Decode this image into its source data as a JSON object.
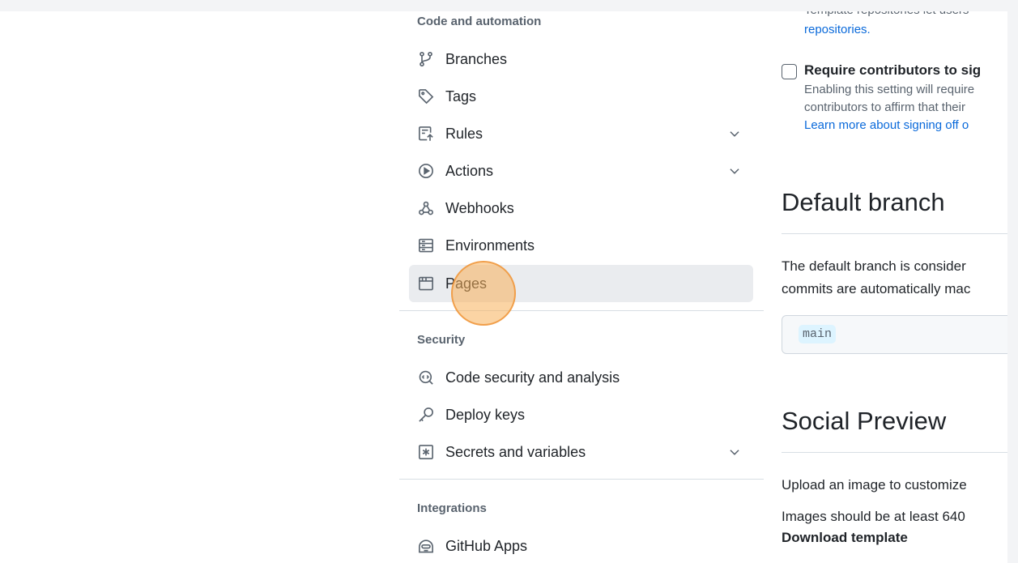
{
  "sidebar": {
    "code_automation": {
      "heading": "Code and automation",
      "items": [
        {
          "label": "Branches",
          "icon": "git-branch-icon"
        },
        {
          "label": "Tags",
          "icon": "tag-icon"
        },
        {
          "label": "Rules",
          "icon": "rules-icon"
        },
        {
          "label": "Actions",
          "icon": "play-icon"
        },
        {
          "label": "Webhooks",
          "icon": "webhook-icon"
        },
        {
          "label": "Environments",
          "icon": "server-icon"
        },
        {
          "label": "Pages",
          "icon": "browser-icon"
        }
      ]
    },
    "security": {
      "heading": "Security",
      "items": [
        {
          "label": "Code security and analysis",
          "icon": "codescan-icon"
        },
        {
          "label": "Deploy keys",
          "icon": "key-icon"
        },
        {
          "label": "Secrets and variables",
          "icon": "asterisk-icon"
        }
      ]
    },
    "integrations": {
      "heading": "Integrations",
      "items": [
        {
          "label": "GitHub Apps",
          "icon": "hubot-icon"
        }
      ]
    }
  },
  "main": {
    "template_text_cut": "Template repositories let users",
    "template_link": "repositories.",
    "signoff": {
      "title": "Require contributors to sig",
      "desc_line1": "Enabling this setting will require",
      "desc_line2": "contributors to affirm that their",
      "link": "Learn more about signing off o"
    },
    "default_branch": {
      "heading": "Default branch",
      "line1": "The default branch is consider",
      "line2": "commits are automatically mac",
      "branch_name": "main"
    },
    "social_preview": {
      "heading": "Social Preview",
      "line1": "Upload an image to customize",
      "line2": "Images should be at least 640",
      "link": "Download template"
    }
  },
  "colors": {
    "accent_link": "#0969da",
    "active_bg": "#eaecef",
    "click_marker": "#f7b05a"
  }
}
